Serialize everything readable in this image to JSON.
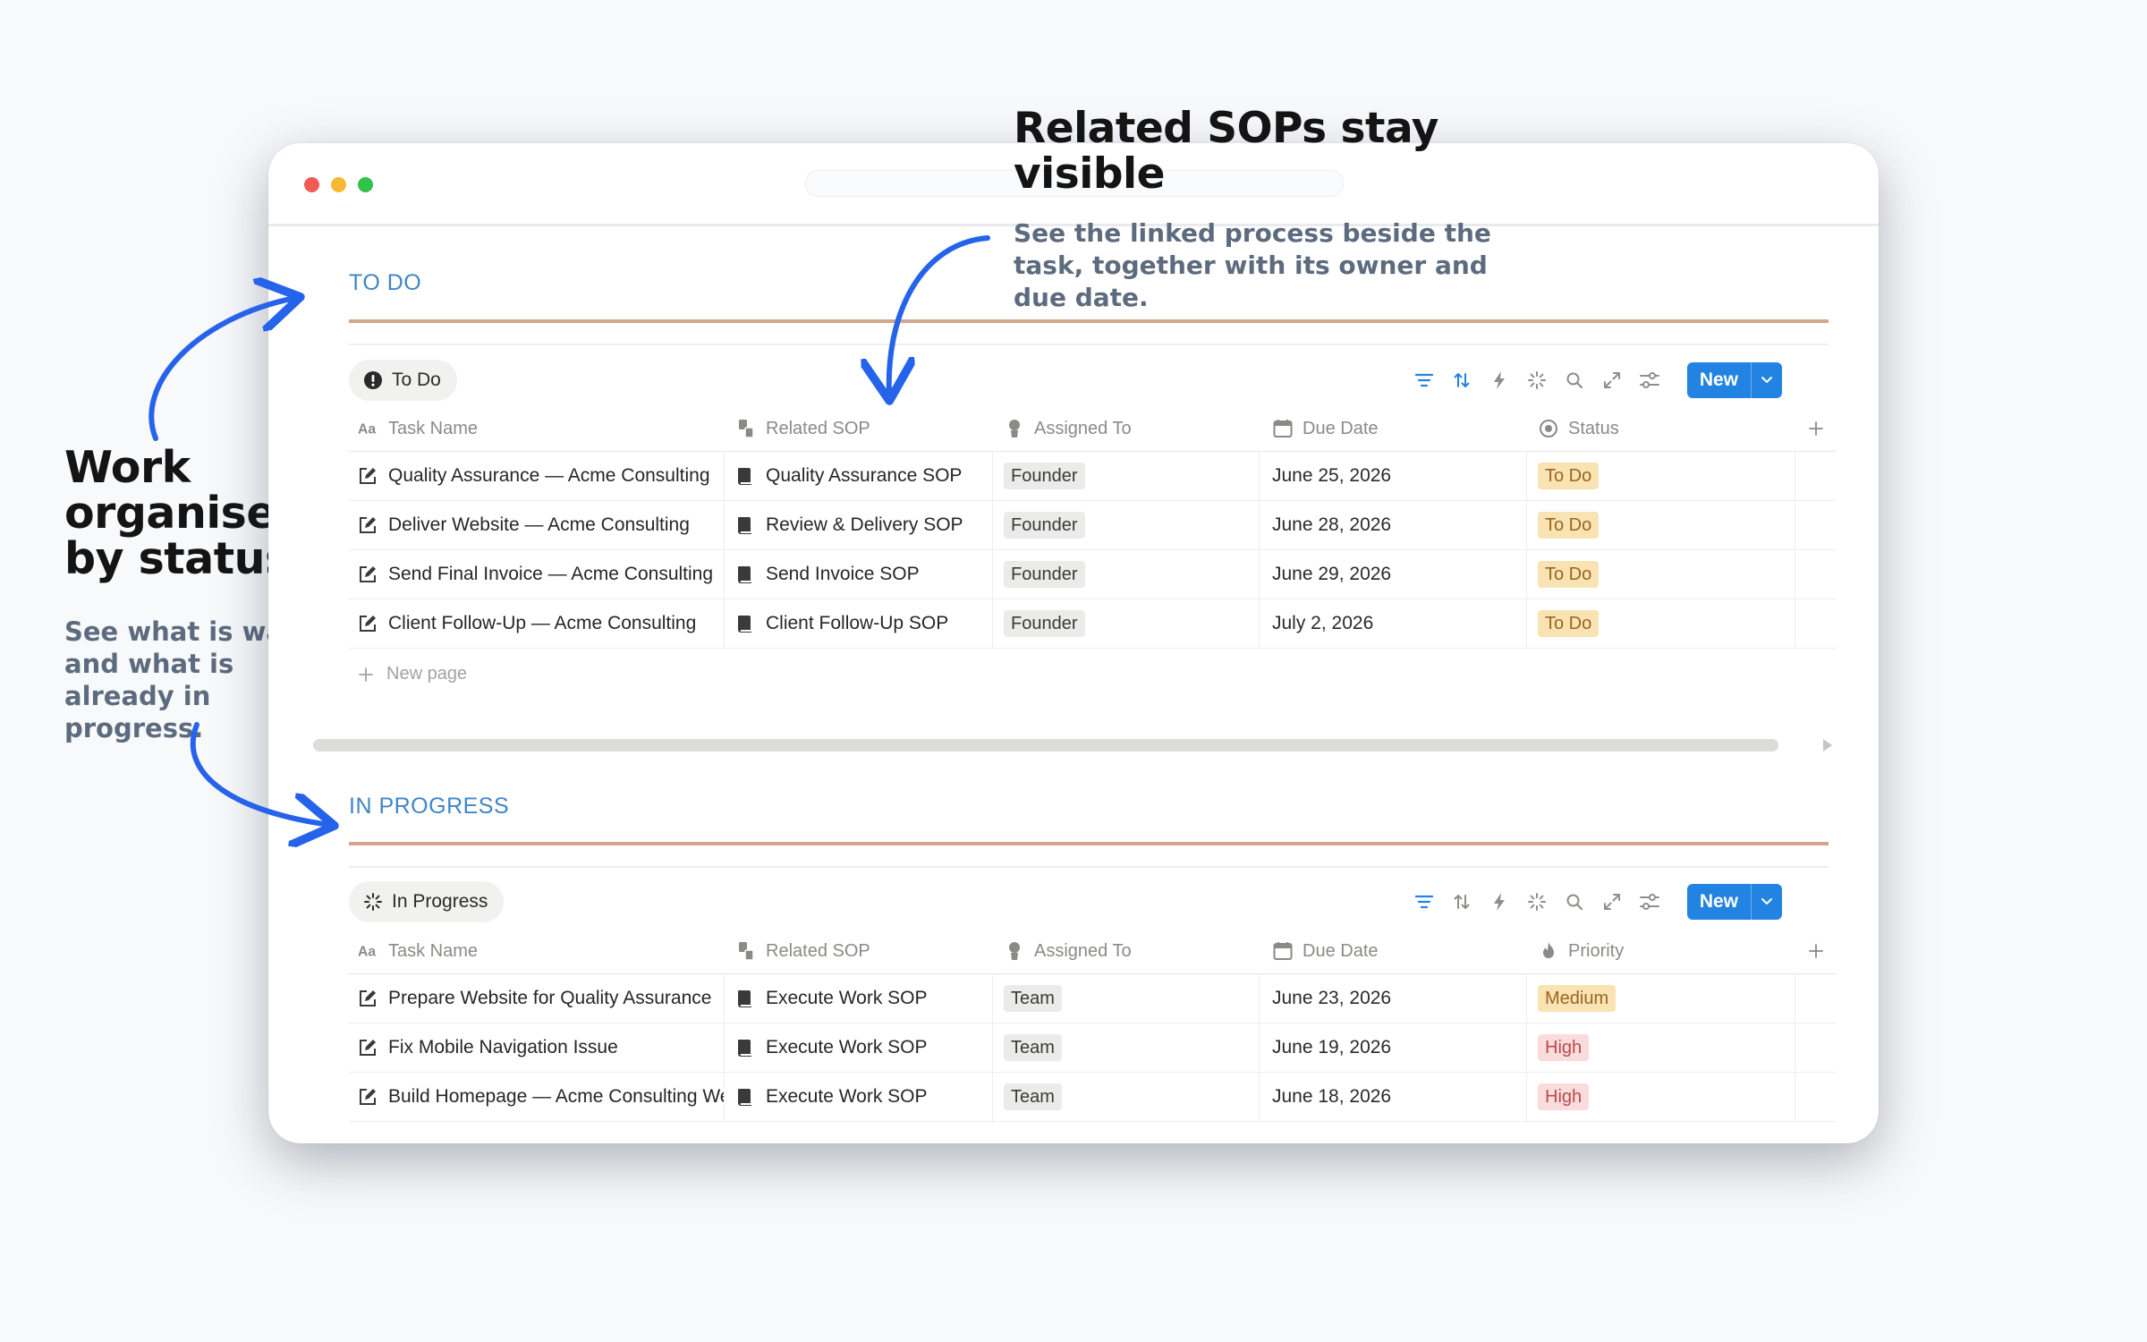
{
  "annotations": {
    "left": {
      "title_lines": [
        "Work",
        "organised",
        "by status"
      ],
      "subtitle_lines": [
        "See what is waiting",
        "and what is",
        "already in",
        "progress."
      ]
    },
    "top": {
      "title_lines": [
        "Related SOPs stay",
        "visible"
      ],
      "subtitle_lines": [
        "See the linked process beside the",
        "task, together with its owner and",
        "due date."
      ]
    }
  },
  "colors": {
    "accent": "#2383e2",
    "section_title": "#3f86c8",
    "section_rule": "#d3a591",
    "arrow": "#2563eb"
  },
  "todo": {
    "section_title": "TO DO",
    "view_label": "To Do",
    "new_button": "New",
    "columns": [
      "Task Name",
      "Related SOP",
      "Assigned To",
      "Due Date",
      "Status"
    ],
    "rows": [
      {
        "task": "Quality Assurance — Acme Consulting",
        "sop": "Quality Assurance SOP",
        "assigned": "Founder",
        "due": "June 25, 2026",
        "status": "To Do"
      },
      {
        "task": "Deliver Website — Acme Consulting",
        "sop": "Review & Delivery SOP",
        "assigned": "Founder",
        "due": "June 28, 2026",
        "status": "To Do"
      },
      {
        "task": "Send Final Invoice — Acme Consulting",
        "sop": "Send Invoice SOP",
        "assigned": "Founder",
        "due": "June 29, 2026",
        "status": "To Do"
      },
      {
        "task": "Client Follow-Up — Acme Consulting",
        "sop": "Client Follow-Up SOP",
        "assigned": "Founder",
        "due": "July 2, 2026",
        "status": "To Do"
      }
    ],
    "new_page": "New page"
  },
  "inprogress": {
    "section_title": "IN PROGRESS",
    "view_label": "In Progress",
    "new_button": "New",
    "columns": [
      "Task Name",
      "Related SOP",
      "Assigned To",
      "Due Date",
      "Priority"
    ],
    "rows": [
      {
        "task": "Prepare Website for Quality Assurance",
        "sop": "Execute Work SOP",
        "assigned": "Team",
        "due": "June 23, 2026",
        "priority": "Medium"
      },
      {
        "task": "Fix Mobile Navigation Issue",
        "sop": "Execute Work SOP",
        "assigned": "Team",
        "due": "June 19, 2026",
        "priority": "High"
      },
      {
        "task": "Build Homepage — Acme Consulting Website",
        "sop": "Execute Work SOP",
        "assigned": "Team",
        "due": "June 18, 2026",
        "priority": "High"
      }
    ]
  }
}
